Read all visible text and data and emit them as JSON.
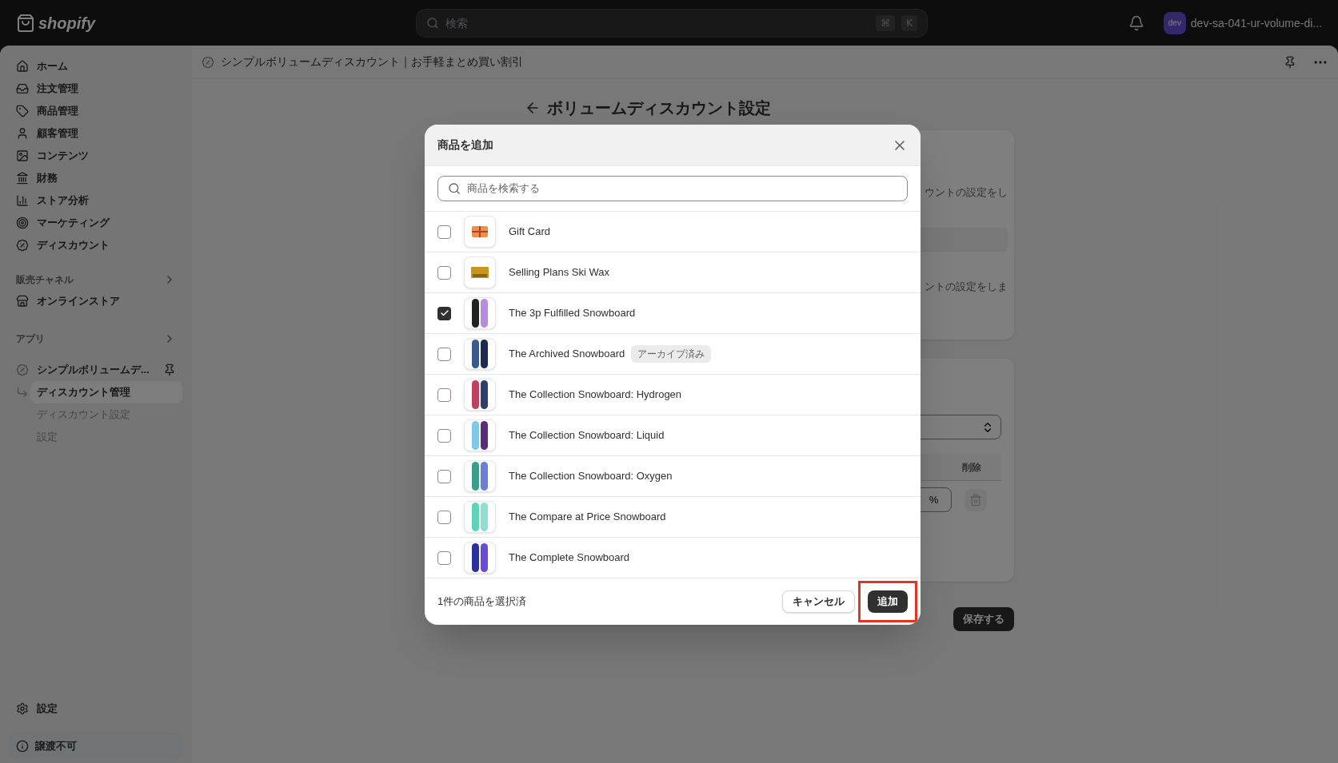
{
  "topbar": {
    "logo": "shopify",
    "search": {
      "placeholder": "検索",
      "keys": [
        "⌘",
        "K"
      ]
    },
    "avatar": "dev",
    "store": "dev-sa-041-ur-volume-di..."
  },
  "sidebar": {
    "items": [
      {
        "label": "ホーム"
      },
      {
        "label": "注文管理"
      },
      {
        "label": "商品管理"
      },
      {
        "label": "顧客管理"
      },
      {
        "label": "コンテンツ"
      },
      {
        "label": "財務"
      },
      {
        "label": "ストア分析"
      },
      {
        "label": "マーケティング"
      },
      {
        "label": "ディスカウント"
      }
    ],
    "sales_channels": {
      "label": "販売チャネル",
      "items": [
        {
          "label": "オンラインストア"
        }
      ]
    },
    "apps": {
      "label": "アプリ",
      "app": {
        "label": "シンプルボリュームデ...",
        "children": [
          {
            "label": "ディスカウント管理",
            "selected": true
          },
          {
            "label": "ディスカウント設定",
            "selected": false
          },
          {
            "label": "設定",
            "selected": false
          }
        ]
      }
    },
    "settings": "設定",
    "footer": "譲渡不可"
  },
  "app_header": {
    "title": "シンプルボリュームディスカウント｜お手軽まとめ買い割引"
  },
  "page": {
    "title": "ボリュームディスカウント設定",
    "card1": {
      "line1": "ウントの設定をし",
      "line2": "ントの設定をしま"
    },
    "card2": {
      "column_delete": "削除",
      "unit": "%"
    },
    "save": "保存する"
  },
  "modal": {
    "title": "商品を追加",
    "search": {
      "placeholder": "商品を検索する"
    },
    "products": [
      {
        "name": "Gift Card",
        "kind": "gift-card",
        "checked": false
      },
      {
        "name": "Selling Plans Ski Wax",
        "kind": "wax",
        "checked": false
      },
      {
        "name": "The 3p Fulfilled Snowboard",
        "kind": "snowboard",
        "checked": true
      },
      {
        "name": "The Archived Snowboard",
        "kind": "snowboard",
        "checked": false,
        "badge": "アーカイブ済み"
      },
      {
        "name": "The Collection Snowboard: Hydrogen",
        "kind": "snowboard",
        "checked": false
      },
      {
        "name": "The Collection Snowboard: Liquid",
        "kind": "snowboard",
        "checked": false
      },
      {
        "name": "The Collection Snowboard: Oxygen",
        "kind": "snowboard",
        "checked": false
      },
      {
        "name": "The Compare at Price Snowboard",
        "kind": "snowboard",
        "checked": false
      },
      {
        "name": "The Complete Snowboard",
        "kind": "snowboard",
        "checked": false
      }
    ],
    "selected_count": "1件の商品を選択済",
    "cancel": "キャンセル",
    "add": "追加",
    "add_highlighted": true
  }
}
